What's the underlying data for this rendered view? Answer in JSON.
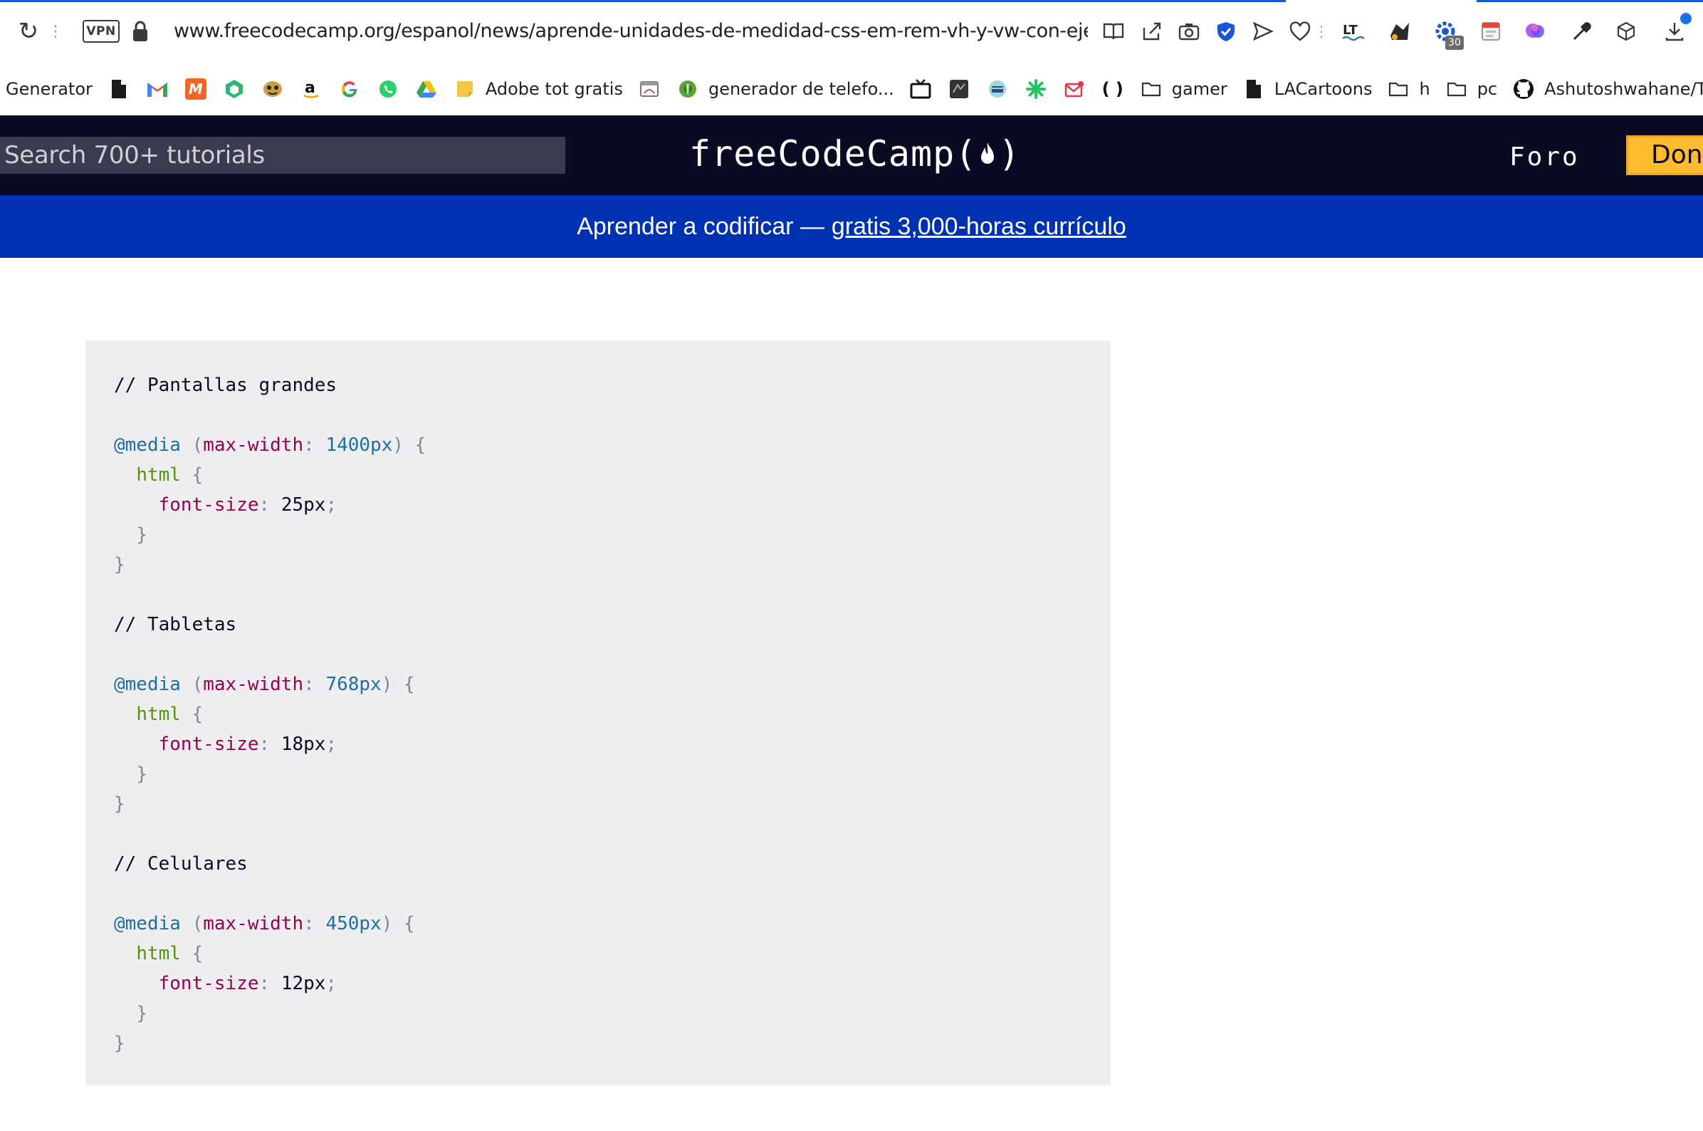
{
  "browser": {
    "vpn_label": "VPN",
    "url": "www.freecodecamp.org/espanol/news/aprende-unidades-de-medidad-css-em-rem-vh-y-vw-con-ejemplos-de",
    "extension_badge": "30"
  },
  "bookmarks": [
    {
      "label": "Generator",
      "icon": "none"
    },
    {
      "label": "",
      "icon": "document-icon"
    },
    {
      "label": "",
      "icon": "gmail-icon"
    },
    {
      "label": "",
      "icon": "m-app-icon"
    },
    {
      "label": "",
      "icon": "hexagon-app-icon"
    },
    {
      "label": "",
      "icon": "mask-icon"
    },
    {
      "label": "",
      "icon": "amazon-icon"
    },
    {
      "label": "",
      "icon": "google-icon"
    },
    {
      "label": "",
      "icon": "whatsapp-icon"
    },
    {
      "label": "",
      "icon": "drive-icon"
    },
    {
      "label": "Adobe tot gratis",
      "icon": "notes-icon"
    },
    {
      "label": "",
      "icon": "window-app-icon"
    },
    {
      "label": "generador de telefo...",
      "icon": "globe-app-icon"
    },
    {
      "label": "",
      "icon": "tv-icon"
    },
    {
      "label": "",
      "icon": "dark-app-icon"
    },
    {
      "label": "",
      "icon": "card-app-icon"
    },
    {
      "label": "",
      "icon": "green-spark-icon"
    },
    {
      "label": "",
      "icon": "mail-app-icon"
    },
    {
      "label": "",
      "icon": "parentheses-icon"
    },
    {
      "label": "gamer",
      "icon": "folder-icon"
    },
    {
      "label": "LACartoons",
      "icon": "document-icon"
    },
    {
      "label": "h",
      "icon": "folder-icon"
    },
    {
      "label": "pc",
      "icon": "folder-icon"
    },
    {
      "label": "Ashutoshwahane/T...",
      "icon": "github-icon"
    }
  ],
  "site_nav": {
    "search_placeholder": "Search 700+ tutorials",
    "logo_text": "freeCodeCamp(",
    "logo_close": ")",
    "forum_label": "Foro",
    "donate_label": "Dona"
  },
  "promo": {
    "text": "Aprender a codificar —",
    "link_text": "gratis 3,000-horas currículo"
  },
  "code": {
    "comment_large": "// Pantallas grandes",
    "comment_tablet": "// Tabletas",
    "comment_mobile": "// Celulares",
    "at_rule": "@media",
    "feature": "max-width",
    "selector": "html",
    "property": "font-size",
    "bp_large": "1400px",
    "bp_tablet": "768px",
    "bp_mobile": "450px",
    "size_large": "25px",
    "size_tablet": "18px",
    "size_mobile": "12px"
  }
}
